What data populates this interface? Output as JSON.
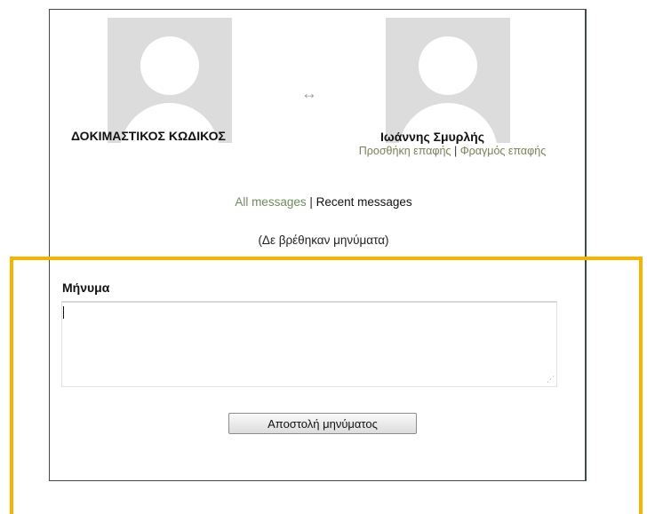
{
  "conversation": {
    "left_user": {
      "name": "ΔΟΚΙΜΑΣΤΙΚΟΣ ΚΩΔΙΚΟΣ"
    },
    "swap_icon": "↔",
    "right_user": {
      "name": "Ιωάννης Σμυρλής",
      "add_contact": "Προσθήκη επαφής",
      "separator": "|",
      "block_contact": "Φραγμός επαφής"
    }
  },
  "filters": {
    "all_messages": "All messages",
    "separator": " | ",
    "recent_messages": "Recent messages"
  },
  "status": {
    "no_messages": "(Δε βρέθηκαν μηνύματα)"
  },
  "compose": {
    "label": "Μήνυμα",
    "textarea_value": "",
    "resize_grip": "⋰",
    "send_button": "Αποστολή μηνύματος"
  },
  "colors": {
    "highlight": "#f6b400",
    "link": "#6f8a5c",
    "avatar_bg": "#dcdcdc"
  }
}
